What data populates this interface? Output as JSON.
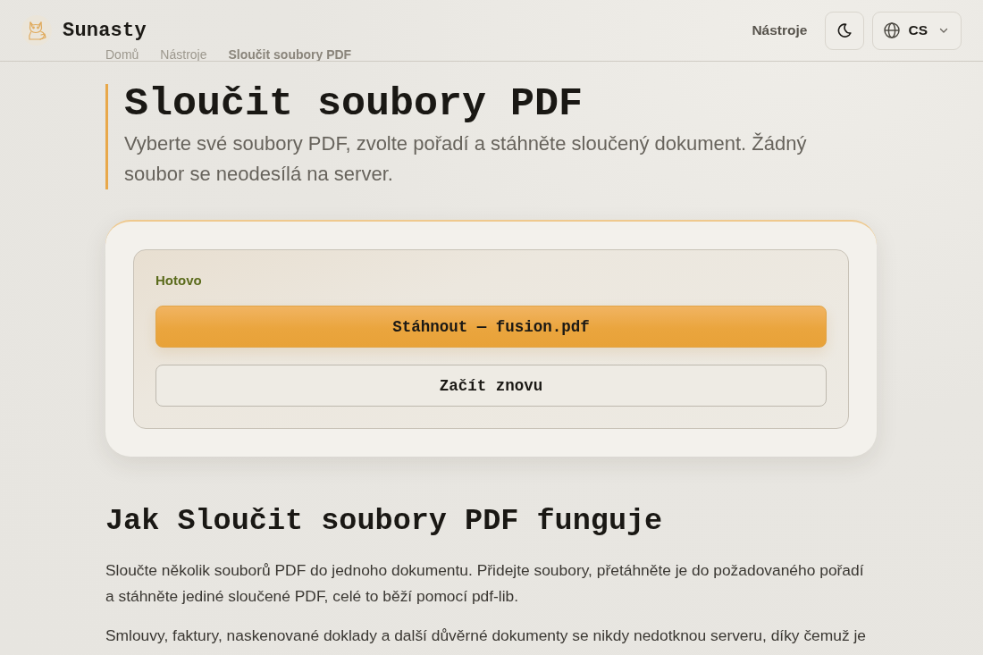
{
  "header": {
    "logo_text": "Sunasty",
    "nav_link": "Nástroje",
    "language": "CS"
  },
  "breadcrumb": [
    {
      "label": "Domů",
      "current": false
    },
    {
      "label": "Nástroje",
      "current": false
    },
    {
      "label": "Sloučit soubory PDF",
      "current": true
    }
  ],
  "hero": {
    "title": "Sloučit soubory PDF",
    "subtitle": "Vyberte své soubory PDF, zvolte pořadí a stáhněte sloučený dokument. Žádný soubor se neodesílá na server."
  },
  "result": {
    "status": "Hotovo",
    "download_button": "Stáhnout — fusion.pdf",
    "restart_button": "Začít znovu"
  },
  "how_it_works": {
    "heading": "Jak Sloučit soubory PDF funguje",
    "paragraphs": [
      "Sloučte několik souborů PDF do jednoho dokumentu. Přidejte soubory, přetáhněte je do požadovaného pořadí a stáhněte jediné sloučené PDF, celé to běží pomocí pdf-lib.",
      "Smlouvy, faktury, naskenované doklady a další důvěrné dokumenty se nikdy nedotknou serveru, díky čemuž je"
    ]
  }
}
